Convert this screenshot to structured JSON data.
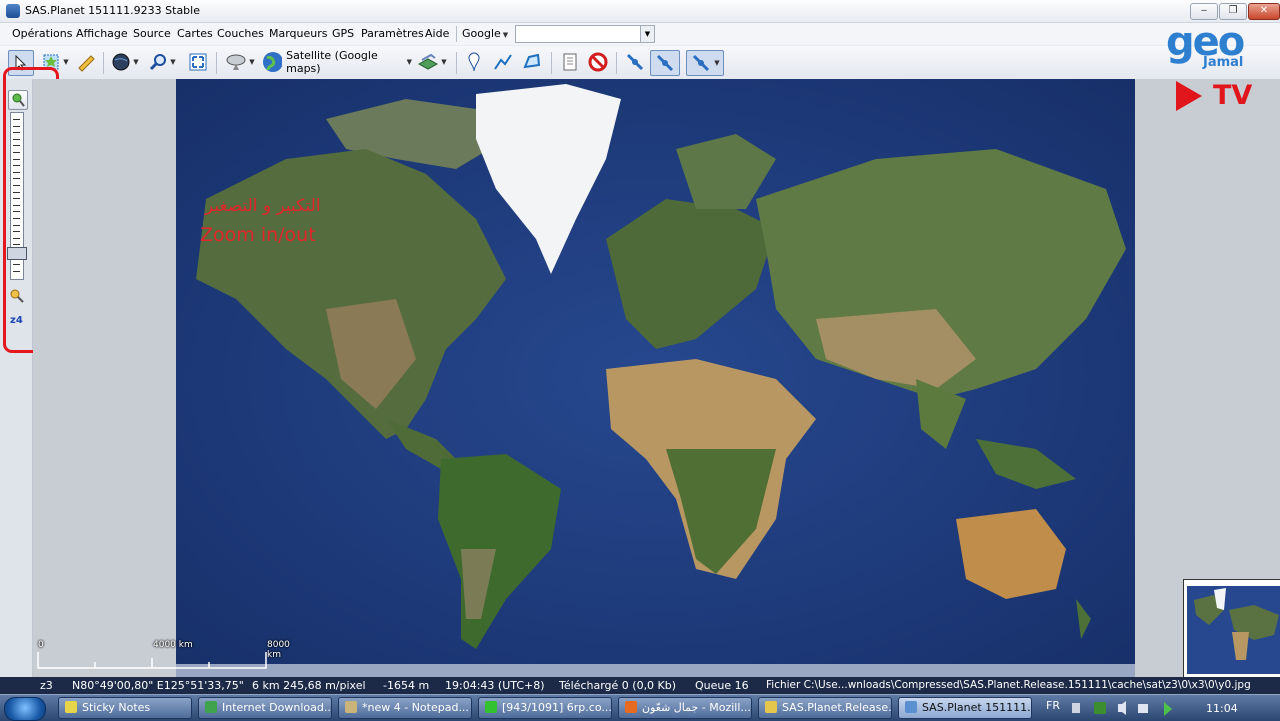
{
  "window": {
    "title": "SAS.Planet 151111.9233 Stable",
    "min": "‒",
    "max": "❐",
    "close": "✕"
  },
  "menu": {
    "items": [
      "Opérations",
      "Affichage",
      "Source",
      "Cartes",
      "Couches",
      "Marqueurs",
      "GPS",
      "Paramètres",
      "Aide"
    ],
    "source_select": "Google",
    "url_value": ""
  },
  "toolbar": {
    "map_type_label": "Satellite (Google maps)"
  },
  "zoom": {
    "level_label": "z4"
  },
  "annotation": {
    "arabic": "التكبير و التصغير",
    "english": "Zoom in/out"
  },
  "scale": {
    "zero": "0",
    "mid": "4000 km",
    "end": "8000 km"
  },
  "status": {
    "zoom": "z3",
    "coords": "N80°49'00,80\" E125°51'33,75\"",
    "resolution": "6 km 245,68 m/pixel",
    "altitude": "-1654 m",
    "time": "19:04:43 (UTC+8)",
    "downloaded": "Téléchargé 0 (0,0 Kb)",
    "queue": "Queue 16",
    "file": "Fichier C:\\Use...wnloads\\Compressed\\SAS.Planet.Release.151111\\cache\\sat\\z3\\0\\x3\\0\\y0.jpg"
  },
  "taskbar": {
    "tasks": [
      {
        "label": "Sticky Notes",
        "icon_color": "#e6d44a"
      },
      {
        "label": "Internet Download...",
        "icon_color": "#3fa34d"
      },
      {
        "label": "*new 4 - Notepad...",
        "icon_color": "#c9b57a"
      },
      {
        "label": "[943/1091] 6rp.co...",
        "icon_color": "#32c12f"
      },
      {
        "label": "جمال شعّون - Mozill...",
        "icon_color": "#e66a1f"
      },
      {
        "label": "SAS.Planet.Release....",
        "icon_color": "#e5c64c"
      },
      {
        "label": "SAS.Planet 151111...",
        "icon_color": "#5a8fd0"
      }
    ],
    "language": "FR",
    "clock": "11:04"
  },
  "logo": {
    "brand": "geo",
    "name": "Jamal",
    "tv": "TV"
  }
}
